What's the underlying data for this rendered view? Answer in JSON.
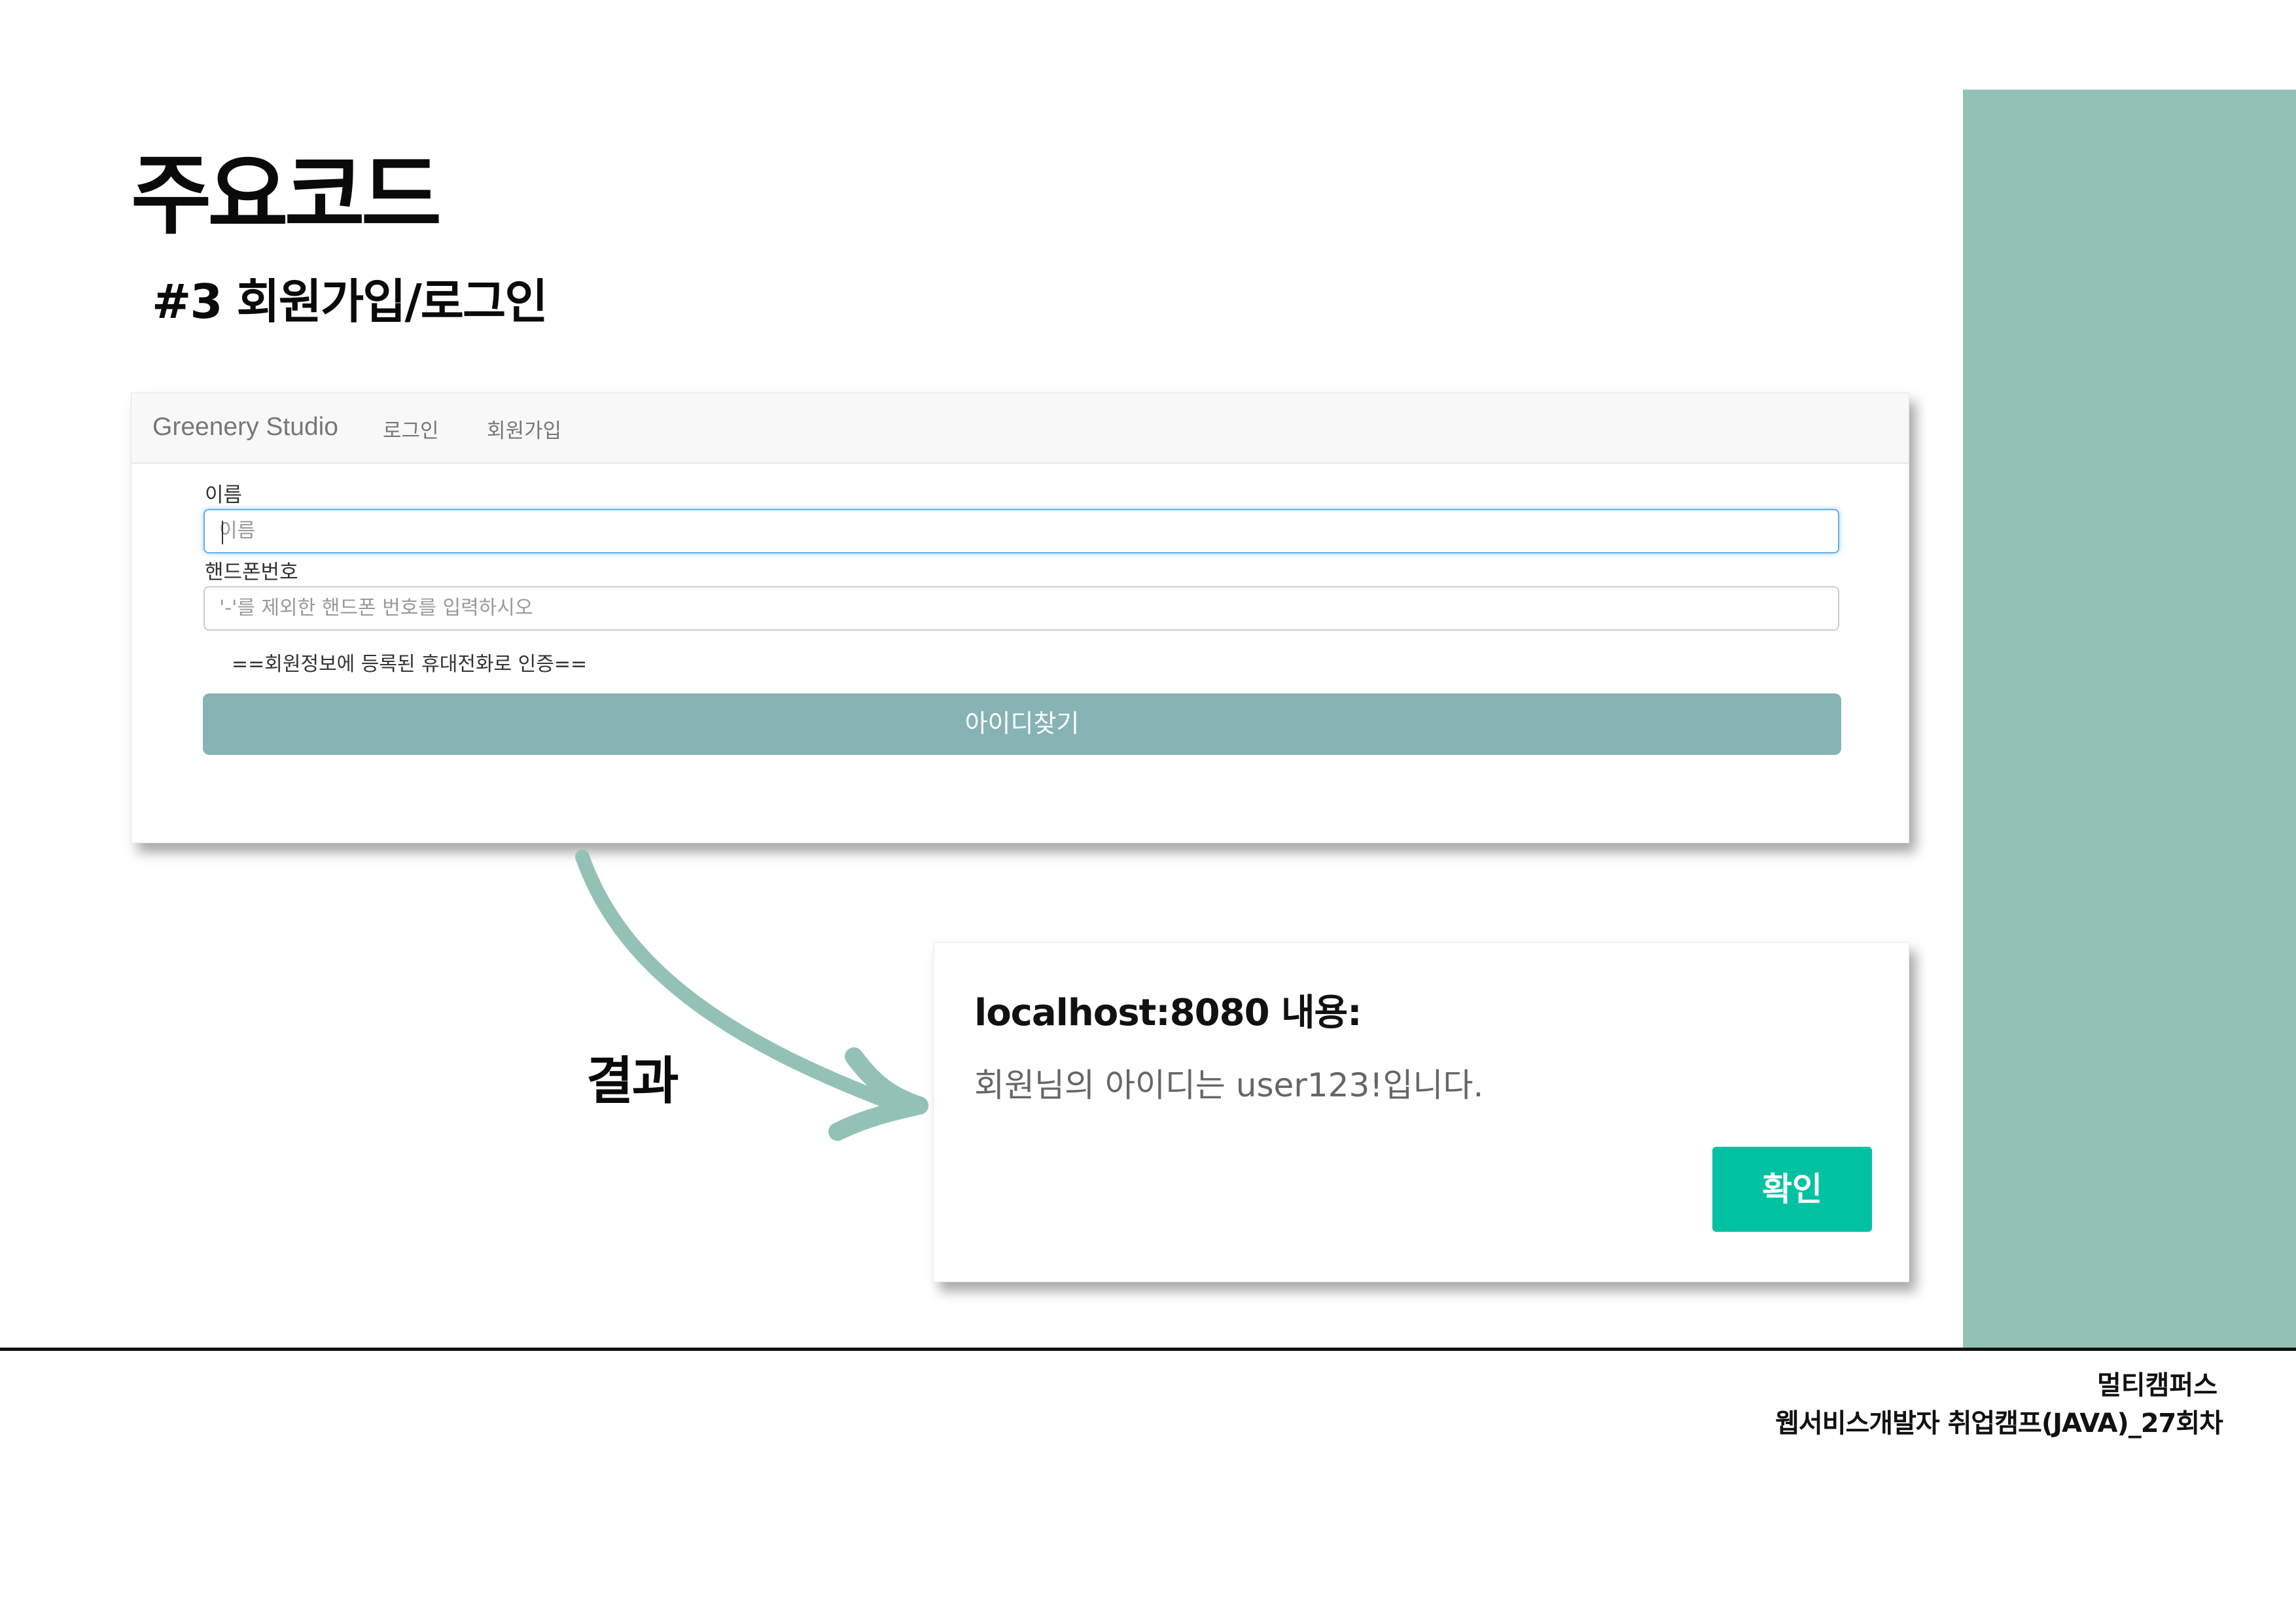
{
  "slide": {
    "title": "주요코드",
    "subtitle": "#3 회원가입/로그인",
    "accent_color": "#93c2b5",
    "result_label": "결과"
  },
  "browser": {
    "navbar": {
      "brand": "Greenery Studio",
      "login": "로그인",
      "signup": "회원가입"
    },
    "form": {
      "name_label": "이름",
      "name_placeholder": "이름",
      "phone_label": "핸드폰번호",
      "phone_placeholder": "'-'를 제외한 핸드폰 번호를 입력하시오",
      "notice": "==회원정보에 등록된 휴대전화로 인증==",
      "find_button": "아이디찾기",
      "button_color": "#86b3b3"
    }
  },
  "dialog": {
    "title": "localhost:8080 내용:",
    "message": "회원님의 아이디는 user123!입니다.",
    "ok_button": "확인",
    "button_color": "#00c2a3"
  },
  "footer": {
    "line1": "멀티캠퍼스",
    "line2": "웹서비스개발자 취업캠프(JAVA)_27회차"
  },
  "icons": {
    "arrow": "curved-arrow-icon"
  }
}
